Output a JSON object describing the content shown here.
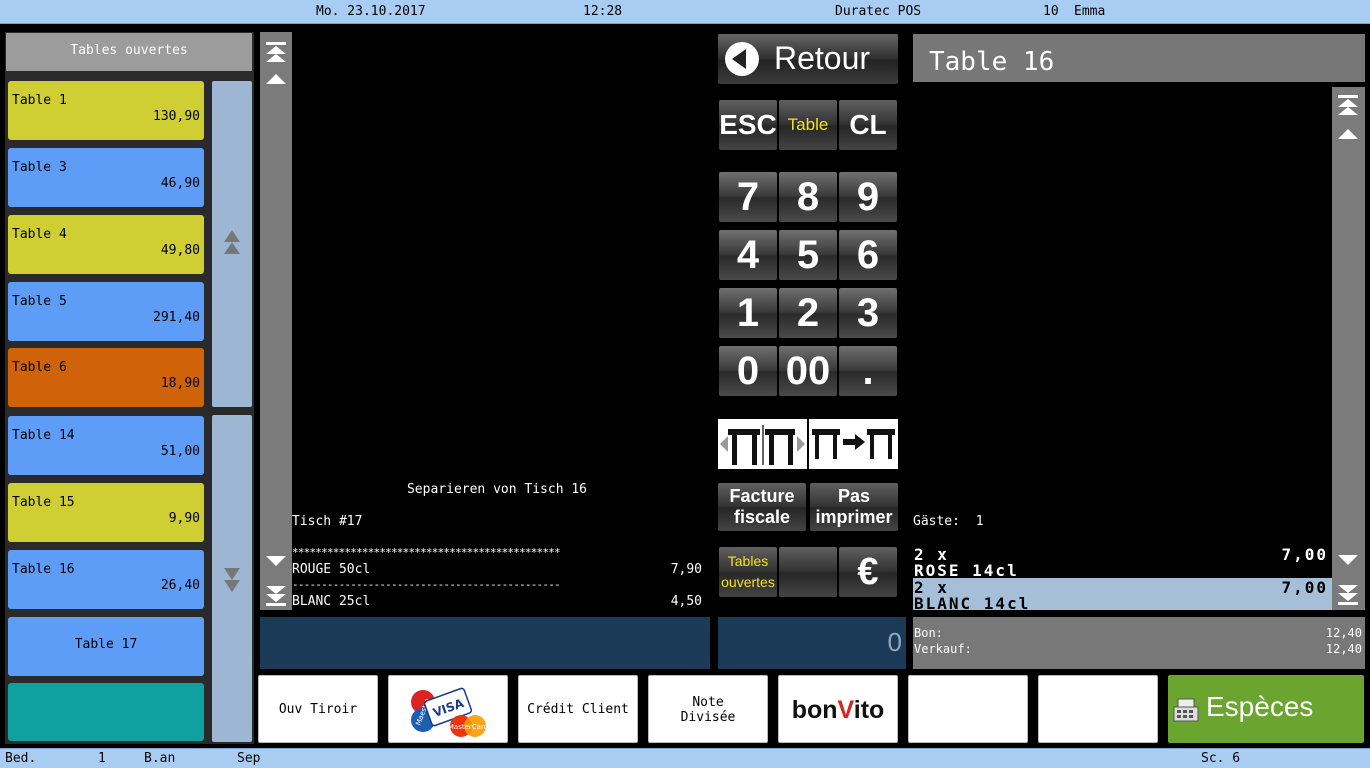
{
  "status_bar": {
    "date": "Mo. 23.10.2017",
    "time": "12:28",
    "app_name": "Duratec POS",
    "user_id": "10",
    "user_name": "Emma"
  },
  "open_tables": {
    "title": "Tables ouvertes",
    "items": [
      {
        "name": "Table 1",
        "amount": "130,90",
        "color": "#cfcf33"
      },
      {
        "name": "Table 3",
        "amount": "46,90",
        "color": "#5e9df7"
      },
      {
        "name": "Table 4",
        "amount": "49,80",
        "color": "#cfcf33"
      },
      {
        "name": "Table 5",
        "amount": "291,40",
        "color": "#5e9df7"
      },
      {
        "name": "Table 6",
        "amount": "18,90",
        "color": "#d0620a"
      },
      {
        "name": "Table 14",
        "amount": "51,00",
        "color": "#5e9df7"
      },
      {
        "name": "Table 15",
        "amount": "9,90",
        "color": "#cfcf33"
      },
      {
        "name": "Table 16",
        "amount": "26,40",
        "color": "#5e9df7"
      },
      {
        "name": "Table 17",
        "amount": "",
        "color": "#5e9df7"
      }
    ],
    "extra_tile_color": "#0fa0a0"
  },
  "receipt": {
    "header": "Separieren von Tisch 16",
    "table_line": "Tisch #17",
    "separator": "**********************************************",
    "lines": [
      {
        "item": "ROUGE 50cl",
        "price": "7,90"
      },
      {
        "item": "BLANC 25cl",
        "price": "4,50"
      }
    ],
    "dash_line": "----------------------------------------------"
  },
  "keypad": {
    "back_label": "Retour",
    "esc": "ESC",
    "table": "Table",
    "cl": "CL",
    "digits": [
      "7",
      "8",
      "9",
      "4",
      "5",
      "6",
      "1",
      "2",
      "3",
      "0",
      "00",
      "."
    ],
    "facture_fiscale": [
      "Facture",
      "fiscale"
    ],
    "pas_imprimer": [
      "Pas",
      "imprimer"
    ],
    "tables_ouvertes": [
      "Tables",
      "ouvertes"
    ],
    "euro": "€",
    "display_value": "0"
  },
  "order": {
    "title": "Table 16",
    "guests_label": "Gäste:",
    "guests": "1",
    "items": [
      {
        "qty": "2 x",
        "price": "7,00",
        "name": "ROSE 14cl",
        "selected": false
      },
      {
        "qty": "2 x",
        "price": "7,00",
        "name": "BLANC 14cl",
        "selected": true
      }
    ],
    "bon_label": "Bon:",
    "bon_value": "12,40",
    "verkauf_label": "Verkauf:",
    "verkauf_value": "12,40"
  },
  "bottom_buttons": {
    "ouv_tiroir": "Ouv Tiroir",
    "card_logos": [
      "Maestro",
      "VISA",
      "MasterCard"
    ],
    "credit_client": "Crédit Client",
    "note_divisee": [
      "Note",
      "Divisée"
    ],
    "bonvito": [
      "bon",
      "V",
      "ito"
    ],
    "especes": "Espèces",
    "especes_color": "#6aa530"
  },
  "footer": {
    "bed_label": "Bed.",
    "bed_value": "1",
    "ban": "B.an",
    "sep": "Sep",
    "sc": "Sc. 6"
  }
}
